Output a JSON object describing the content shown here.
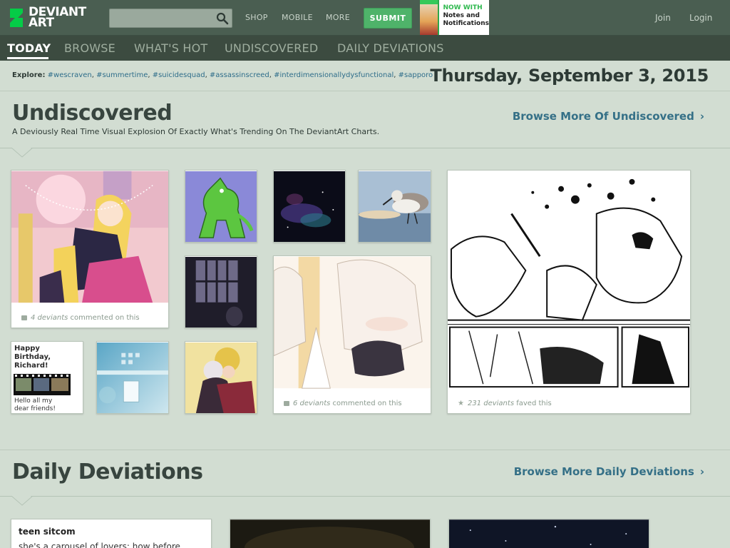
{
  "topbar": {
    "logo_line1": "DEVIANT",
    "logo_line2": "ART",
    "search_placeholder": "",
    "nav": [
      "SHOP",
      "MOBILE",
      "MORE"
    ],
    "submit_label": "SUBMIT",
    "promo_line1": "NOW WITH",
    "promo_line2": "Notes and",
    "promo_line3": "Notifications",
    "join_label": "Join",
    "login_label": "Login"
  },
  "tabs": [
    "TODAY",
    "BROWSE",
    "WHAT'S HOT",
    "UNDISCOVERED",
    "DAILY DEVIATIONS"
  ],
  "explore": {
    "label": "Explore:",
    "tags": [
      "#wescraven",
      "#summertime",
      "#suicidesquad",
      "#assassinscreed",
      "#interdimensionallydysfunctional",
      "#sapporo"
    ]
  },
  "date": "Thursday, September 3, 2015",
  "undiscovered": {
    "title": "Undiscovered",
    "subtitle": "A Deviously Real Time Visual Explosion Of Exactly What's Trending On The DeviantArt Charts.",
    "more_label": "Browse More Of Undiscovered",
    "chevron": "›",
    "thumb1_count": "4 deviants",
    "thumb1_text": "commented on this",
    "thumb_birthday_title": "Happy Birthday, Richard!",
    "thumb_birthday_line1": "Hello all my",
    "thumb_birthday_line2": "dear friends!",
    "thumb_manga_count": "6 deviants",
    "thumb_manga_text": "commented on this",
    "thumb_comic_count": "231 deviants",
    "thumb_comic_text": "faved this"
  },
  "daily": {
    "title": "Daily Deviations",
    "more_label": "Browse More Daily Deviations",
    "chevron": "›",
    "card_title": "teen sitcom",
    "card_body": "she's a carousel of lovers; how before"
  },
  "colors": {
    "topbar": "#4a5e51",
    "tabbar": "#3c4b40",
    "page_bg": "#d2ddd2",
    "submit": "#4fb36a",
    "link": "#357087"
  }
}
